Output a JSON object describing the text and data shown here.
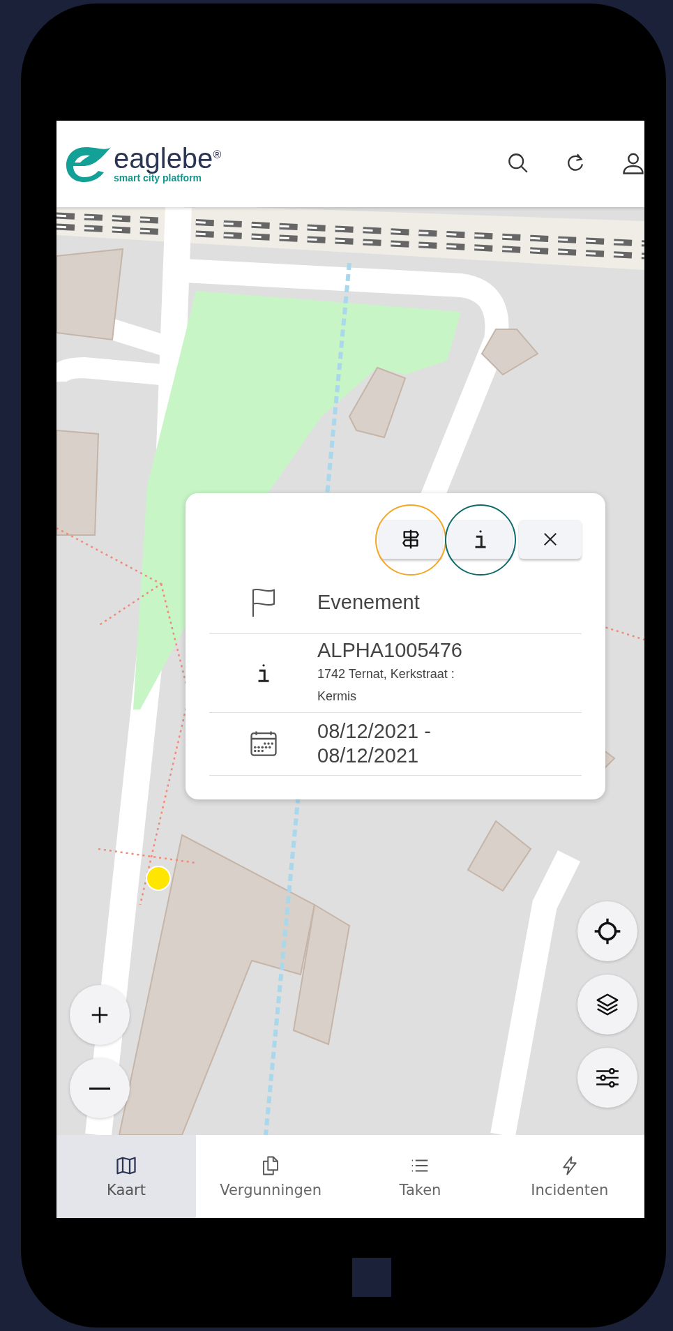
{
  "header": {
    "logo": {
      "name": "eaglebe$^{®}$",
      "tagline": "smart city platform"
    },
    "actions": [
      {
        "kind": "search"
      },
      {
        "kind": "refresh"
      },
      {
        "kind": "user"
      }
    ]
  },
  "map": {
    "zoom_controls": [
      {
        "kind": "zoom-in"
      },
      {
        "kind": "zoom-out"
      }
    ],
    "tools": [
      {
        "kind": "locate"
      },
      {
        "kind": "layers"
      },
      {
        "kind": "filter"
      }
    ]
  },
  "popup": {
    "actions": [
      {
        "kind": "directions",
        "color": "#f5a623"
      },
      {
        "kind": "info",
        "color": "#0e6b6b"
      },
      {
        "kind": "close"
      }
    ],
    "rows": [
      {
        "kind": "type",
        "title": "Evenement"
      },
      {
        "kind": "info",
        "title": "ALPHA1005476",
        "detail": "1742 Ternat, Kerkstraat : Kermis"
      },
      {
        "kind": "date",
        "title": "08/12/2021 - 08/12/2021"
      }
    ]
  },
  "nav": [
    {
      "kind": "map",
      "label": "Kaart",
      "selected": true
    },
    {
      "kind": "documents",
      "label": "Vergunningen",
      "selected": false
    },
    {
      "kind": "list",
      "label": "Taken",
      "selected": false
    },
    {
      "kind": "bolt",
      "label": "Incidenten",
      "selected": false
    }
  ]
}
